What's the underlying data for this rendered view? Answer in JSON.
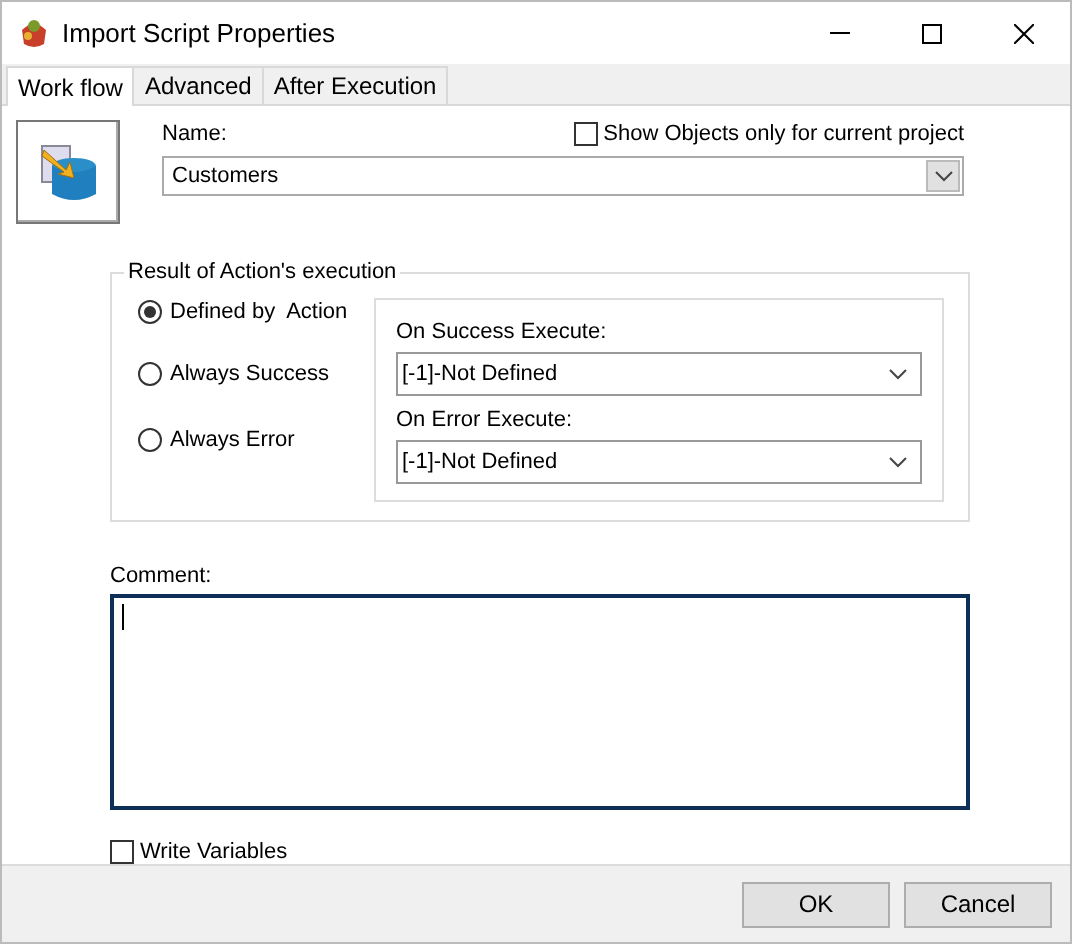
{
  "window": {
    "title": "Import Script Properties"
  },
  "tabs": [
    {
      "label": "Work flow",
      "selected": true
    },
    {
      "label": "Advanced",
      "selected": false
    },
    {
      "label": "After Execution",
      "selected": false
    }
  ],
  "name_field": {
    "label": "Name:",
    "value": "Customers"
  },
  "show_objects_checkbox": {
    "label": "Show Objects only for current project",
    "checked": false
  },
  "result_group": {
    "title": "Result of Action's execution",
    "options": [
      {
        "label": "Defined by  Action",
        "selected": true
      },
      {
        "label": "Always Success",
        "selected": false
      },
      {
        "label": "Always Error",
        "selected": false
      }
    ],
    "on_success": {
      "label": "On Success Execute:",
      "value": "[-1]-Not Defined"
    },
    "on_error": {
      "label": "On Error Execute:",
      "value": "[-1]-Not Defined"
    }
  },
  "comment": {
    "label": "Comment:",
    "focused": true
  },
  "write_variables_checkbox": {
    "label": "Write Variables",
    "checked": false
  },
  "buttons": [
    "OK",
    "Cancel"
  ]
}
